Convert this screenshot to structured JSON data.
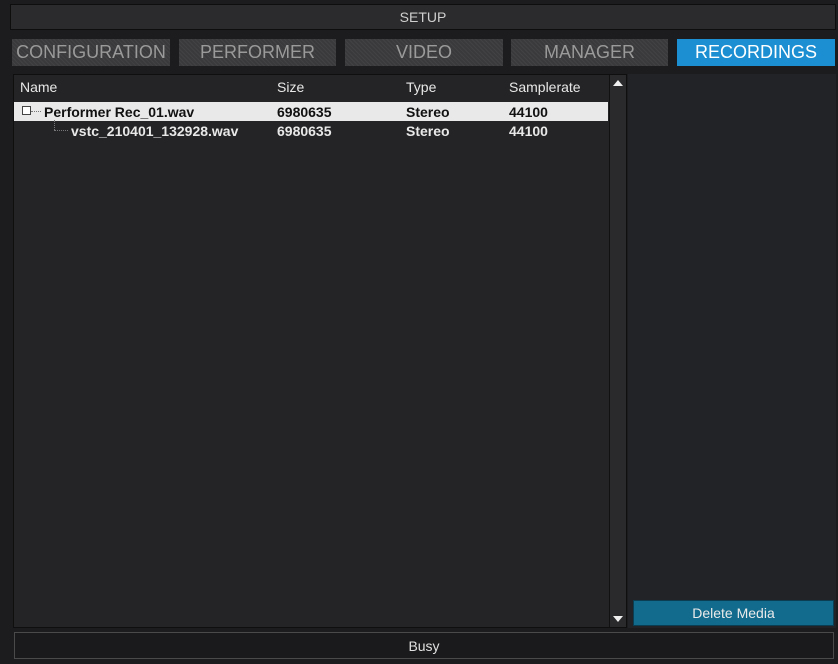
{
  "window": {
    "title": "SETUP"
  },
  "tabs": [
    {
      "label": "CONFIGURATION",
      "active": false
    },
    {
      "label": "PERFORMER",
      "active": false
    },
    {
      "label": "VIDEO",
      "active": false
    },
    {
      "label": "MANAGER",
      "active": false
    },
    {
      "label": "RECORDINGS",
      "active": true
    }
  ],
  "table": {
    "columns": [
      "Name",
      "Size",
      "Type",
      "Samplerate"
    ],
    "rows": [
      {
        "name": "Performer Rec_01.wav",
        "size": "6980635",
        "type": "Stereo",
        "samplerate": "44100",
        "selected": true,
        "level": 0
      },
      {
        "name": "vstc_210401_132928.wav",
        "size": "6980635",
        "type": "Stereo",
        "samplerate": "44100",
        "selected": false,
        "level": 1
      }
    ]
  },
  "actions": {
    "delete_label": "Delete Media"
  },
  "status": {
    "text": "Busy"
  },
  "colors": {
    "accent": "#1b8fd1",
    "delete_button": "#126b8c",
    "selected_row": "#e9e9e9"
  },
  "icons": [
    "expand-box-icon",
    "scroll-up-arrow-icon",
    "scroll-down-arrow-icon"
  ]
}
